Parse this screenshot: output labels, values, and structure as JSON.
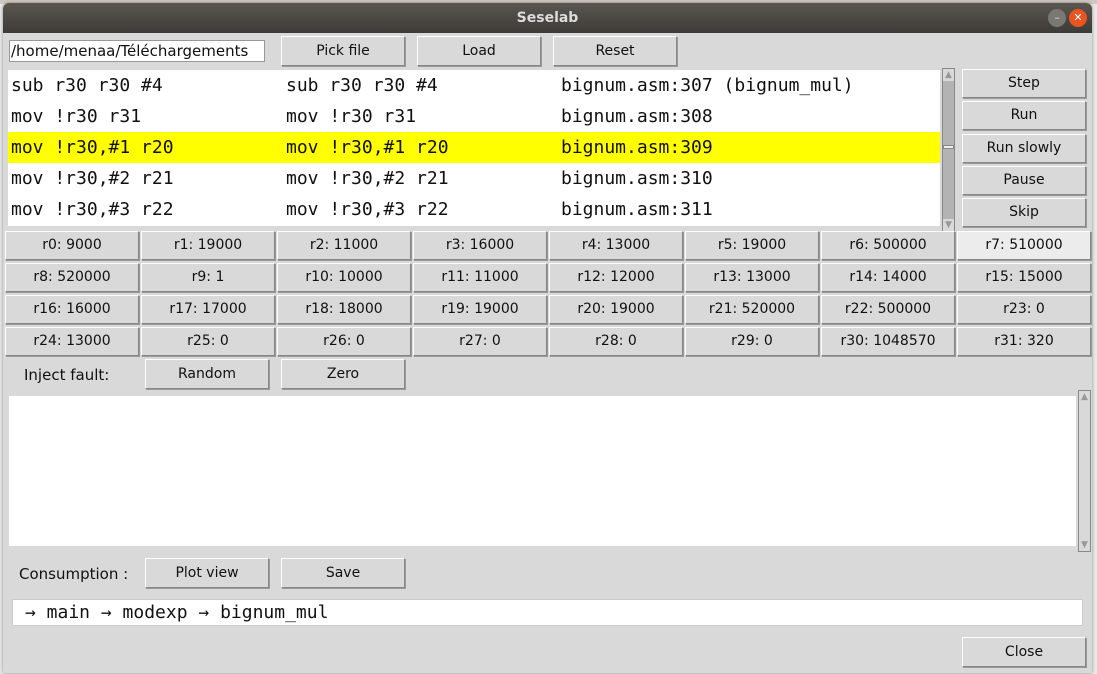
{
  "window": {
    "title": "Seselab"
  },
  "file": {
    "path": "/home/menaa/Téléchargements",
    "pick_label": "Pick file",
    "load_label": "Load",
    "reset_label": "Reset"
  },
  "listing": {
    "highlight_color": "#ffff00",
    "rows": [
      {
        "c1": "sub r30 r30 #4",
        "c2": "sub r30 r30 #4",
        "c3": "bignum.asm:307 (bignum_mul)",
        "current": false
      },
      {
        "c1": "mov !r30 r31",
        "c2": "mov !r30 r31",
        "c3": "bignum.asm:308",
        "current": false
      },
      {
        "c1": "mov !r30,#1 r20",
        "c2": "mov !r30,#1 r20",
        "c3": "bignum.asm:309",
        "current": true
      },
      {
        "c1": "mov !r30,#2 r21",
        "c2": "mov !r30,#2 r21",
        "c3": "bignum.asm:310",
        "current": false
      },
      {
        "c1": "mov !r30,#3 r22",
        "c2": "mov !r30,#3 r22",
        "c3": "bignum.asm:311",
        "current": false
      }
    ]
  },
  "controls": [
    "Step",
    "Run",
    "Run slowly",
    "Pause",
    "Skip"
  ],
  "registers": [
    "r0: 9000",
    "r1: 19000",
    "r2: 11000",
    "r3: 16000",
    "r4: 13000",
    "r5: 19000",
    "r6: 500000",
    "r7: 510000",
    "r8: 520000",
    "r9: 1",
    "r10: 10000",
    "r11: 11000",
    "r12: 12000",
    "r13: 13000",
    "r14: 14000",
    "r15: 15000",
    "r16: 16000",
    "r17: 17000",
    "r18: 18000",
    "r19: 19000",
    "r20: 19000",
    "r21: 520000",
    "r22: 500000",
    "r23: 0",
    "r24: 13000",
    "r25: 0",
    "r26: 0",
    "r27: 0",
    "r28: 0",
    "r29: 0",
    "r30: 1048570",
    "r31: 320"
  ],
  "fault": {
    "label": "Inject fault:",
    "random_label": "Random",
    "zero_label": "Zero"
  },
  "consumption": {
    "label": "Consumption :",
    "plot_label": "Plot view",
    "save_label": "Save"
  },
  "callstack": "→ main → modexp → bignum_mul",
  "close_label": "Close"
}
